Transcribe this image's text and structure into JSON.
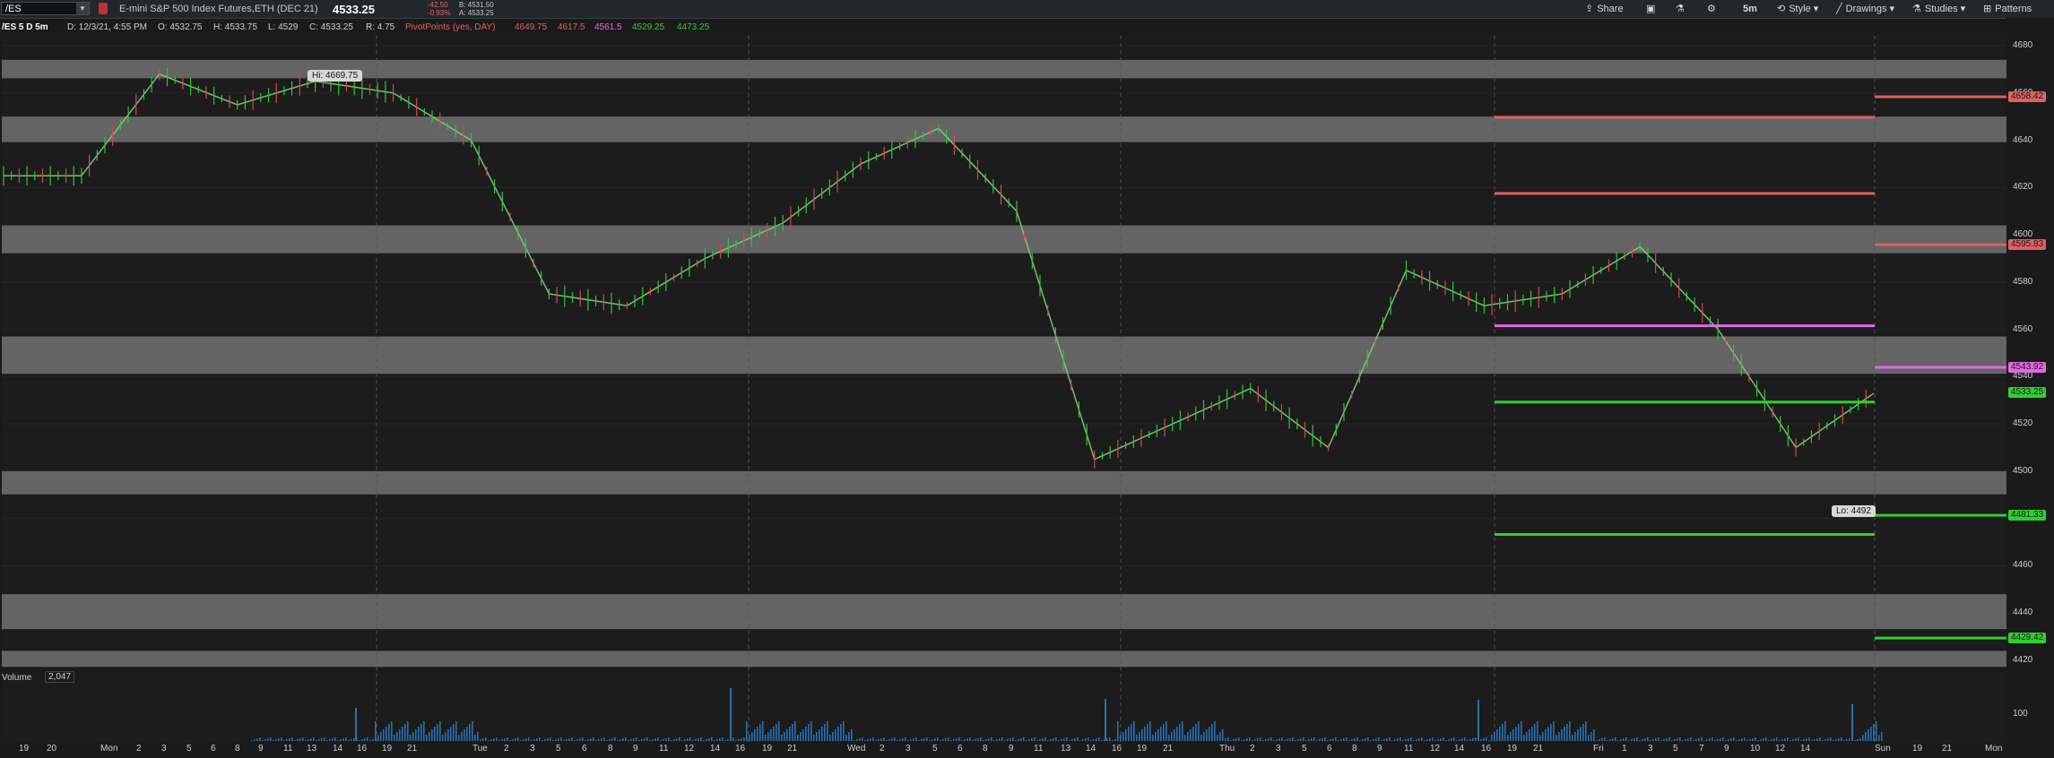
{
  "header": {
    "symbol": "/ES",
    "description": "E-mini S&P 500 Index Futures,ETH (DEC 21)",
    "last": "4533.25",
    "change": "-42.50",
    "change_pct": "-0.93%",
    "bid": "B: 4531.50",
    "ask": "A: 4533.25"
  },
  "toolbar": {
    "share": "Share",
    "interval": "5m",
    "style": "Style",
    "drawings": "Drawings",
    "studies": "Studies",
    "patterns": "Patterns"
  },
  "infobar": {
    "label": "/ES 5 D 5m",
    "date": "D: 12/3/21, 4:55 PM",
    "open": "O: 4532.75",
    "high": "H: 4533.75",
    "low": "L: 4529",
    "close": "C: 4533.25",
    "range": "R: 4.75",
    "study": "PivotPoints (yes, DAY)",
    "pv1": "4649.75",
    "pv2": "4617.5",
    "pv3": "4561.5",
    "pv4": "4529.25",
    "pv5": "4473.25"
  },
  "colors": {
    "red": "#e06060",
    "magenta": "#e466e4",
    "green": "#2fcf2f",
    "zone": "#6d6d6d"
  },
  "price_axis": {
    "labels": [
      "4680",
      "4660",
      "4640",
      "4620",
      "4600",
      "4580",
      "4560",
      "4540",
      "4520",
      "4500",
      "4480",
      "4460",
      "4440",
      "4420"
    ],
    "tags": [
      {
        "text": "4658.42",
        "color": "#e06060",
        "price": 4658.42
      },
      {
        "text": "4595.83",
        "color": "#e06060",
        "price": 4595.83
      },
      {
        "text": "4543.92",
        "color": "#e466e4",
        "price": 4543.92
      },
      {
        "text": "4533.25",
        "color": "#2fcf2f",
        "price": 4533.25
      },
      {
        "text": "4481.33",
        "color": "#2fcf2f",
        "price": 4481.33
      },
      {
        "text": "4429.42",
        "color": "#2fcf2f",
        "price": 4429.42
      }
    ]
  },
  "annotations": {
    "hi": "Hi: 4669.75",
    "lo": "Lo: 4492"
  },
  "volume": {
    "label": "Volume",
    "value": "2,047",
    "axis_label": "100"
  },
  "x_labels": [
    "19",
    "20",
    "Mon",
    "2",
    "3",
    "5",
    "6",
    "8",
    "9",
    "11",
    "13",
    "14",
    "16",
    "19",
    "21",
    "Tue",
    "2",
    "3",
    "5",
    "6",
    "8",
    "9",
    "11",
    "12",
    "14",
    "16",
    "19",
    "21",
    "Wed",
    "2",
    "3",
    "5",
    "6",
    "8",
    "9",
    "11",
    "13",
    "14",
    "16",
    "19",
    "21",
    "Thu",
    "2",
    "3",
    "5",
    "6",
    "8",
    "9",
    "11",
    "12",
    "14",
    "16",
    "19",
    "21",
    "Fri",
    "1",
    "3",
    "5",
    "7",
    "9",
    "10",
    "12",
    "14",
    "Sun",
    "19",
    "21",
    "Mon"
  ],
  "chart_data": {
    "type": "line",
    "title": "/ES 5 D 5m",
    "ylim": [
      4415,
      4690
    ],
    "series": [
      {
        "name": "/ES",
        "x": [
          "Mon",
          "Mon 9",
          "Mon 13",
          "Mon 16",
          "Mon 21",
          "Tue",
          "Tue 9",
          "Tue 11",
          "Tue 14",
          "Tue 21",
          "Wed",
          "Wed 9",
          "Wed 11",
          "Wed 14",
          "Wed 16",
          "Thu",
          "Thu 9",
          "Thu 11",
          "Thu 16",
          "Thu 21",
          "Fri",
          "Fri 9",
          "Fri 10",
          "Fri 14",
          "Fri 16"
        ],
        "values": [
          4625,
          4625,
          4668,
          4655,
          4665,
          4660,
          4640,
          4575,
          4570,
          4590,
          4605,
          4630,
          4645,
          4610,
          4505,
          4520,
          4535,
          4510,
          4585,
          4570,
          4575,
          4595,
          4560,
          4510,
          4533
        ]
      }
    ],
    "pivot_levels_current": [
      4649.75,
      4617.5,
      4561.5,
      4529.25,
      4473.25
    ],
    "pivot_levels_next": [
      4658.42,
      4595.83,
      4543.92,
      4481.33,
      4429.42
    ],
    "hi": 4669.75,
    "lo": 4492
  }
}
